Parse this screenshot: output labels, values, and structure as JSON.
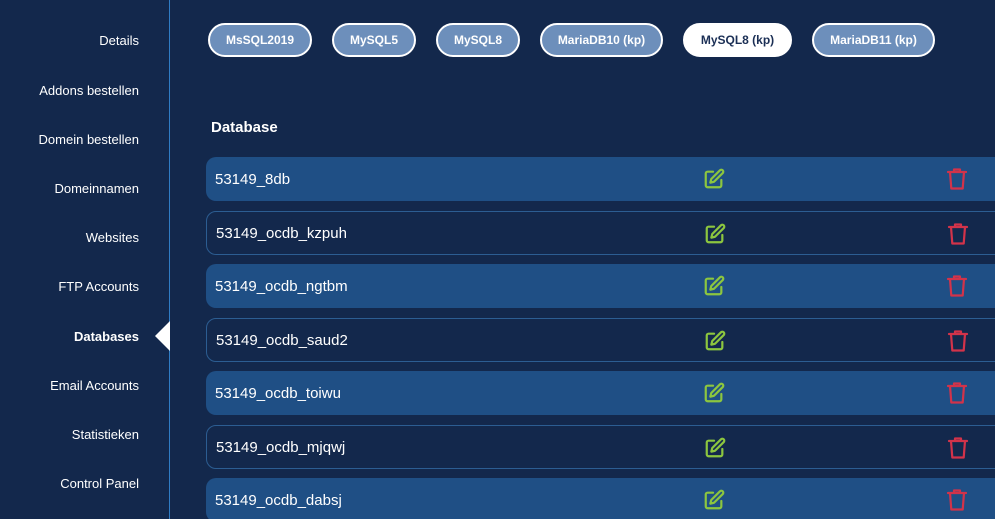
{
  "sidebar": {
    "items": [
      {
        "label": "Details"
      },
      {
        "label": "Addons bestellen"
      },
      {
        "label": "Domein bestellen"
      },
      {
        "label": "Domeinnamen"
      },
      {
        "label": "Websites"
      },
      {
        "label": "FTP Accounts"
      },
      {
        "label": "Databases",
        "active": true
      },
      {
        "label": "Email Accounts"
      },
      {
        "label": "Statistieken"
      },
      {
        "label": "Control Panel"
      }
    ]
  },
  "tabs": [
    {
      "label": "MsSQL2019"
    },
    {
      "label": "MySQL5"
    },
    {
      "label": "MySQL8"
    },
    {
      "label": "MariaDB10 (kp)"
    },
    {
      "label": "MySQL8 (kp)",
      "active": true
    },
    {
      "label": "MariaDB11 (kp)"
    }
  ],
  "main": {
    "title": "Database",
    "databases": [
      {
        "name": "53149_8db"
      },
      {
        "name": "53149_ocdb_kzpuh"
      },
      {
        "name": "53149_ocdb_ngtbm"
      },
      {
        "name": "53149_ocdb_saud2"
      },
      {
        "name": "53149_ocdb_toiwu"
      },
      {
        "name": "53149_ocdb_mjqwj"
      },
      {
        "name": "53149_ocdb_dabsj"
      }
    ]
  },
  "colors": {
    "background": "#13284c",
    "row_filled": "#1f4f85",
    "tab_inactive": "#6d8fbb",
    "edit_icon": "#8cc63f",
    "delete_icon": "#d2334a",
    "sidebar_divider": "#2f7cc4"
  },
  "icons": {
    "edit": "edit-icon",
    "delete": "trash-icon"
  }
}
